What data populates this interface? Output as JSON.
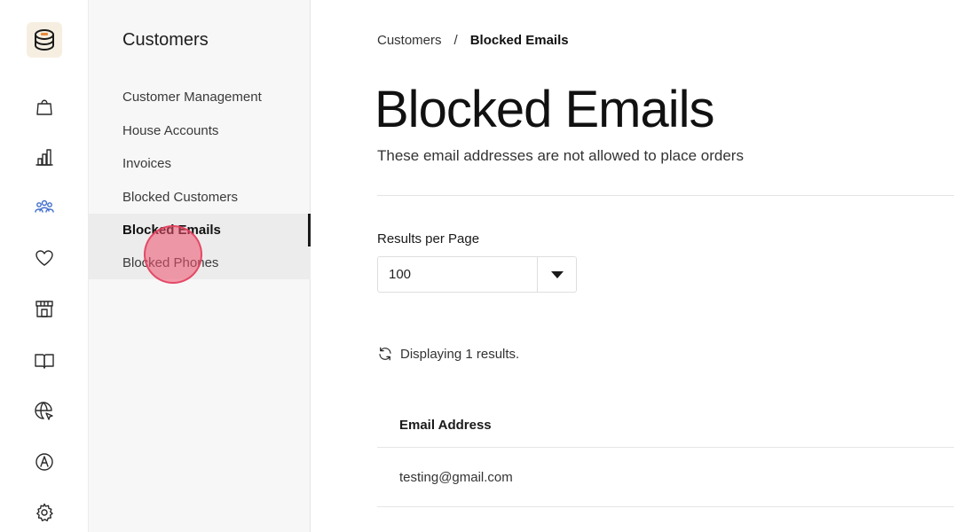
{
  "rail": {
    "icons": [
      "logo-icon",
      "shopping-bag-icon",
      "bar-chart-icon",
      "people-icon",
      "heart-icon",
      "store-icon",
      "book-icon",
      "globe-cursor-icon",
      "compass-icon",
      "gear-icon"
    ],
    "active_color": "#3f6dcc"
  },
  "subnav": {
    "title": "Customers",
    "items": [
      {
        "label": "Customer Management"
      },
      {
        "label": "House Accounts"
      },
      {
        "label": "Invoices"
      },
      {
        "label": "Blocked Customers"
      },
      {
        "label": "Blocked Emails"
      },
      {
        "label": "Blocked Phones"
      }
    ]
  },
  "breadcrumb": {
    "parent": "Customers",
    "separator": "/",
    "current": "Blocked Emails"
  },
  "page": {
    "title": "Blocked Emails",
    "subtitle": "These email addresses are not allowed to place orders"
  },
  "results_per_page": {
    "label": "Results per Page",
    "selected": "100"
  },
  "results": {
    "text": "Displaying 1 results."
  },
  "table": {
    "headers": [
      "Email Address"
    ],
    "rows": [
      [
        "testing@gmail.com"
      ]
    ]
  }
}
